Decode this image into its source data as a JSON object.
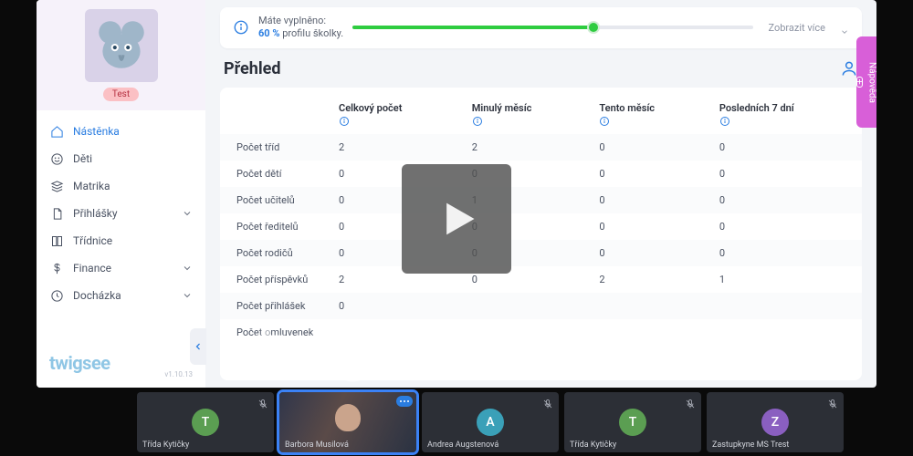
{
  "sidebar": {
    "badge": "Test",
    "items": [
      {
        "label": "Nástěnka",
        "icon": "home",
        "active": true,
        "expandable": false
      },
      {
        "label": "Děti",
        "icon": "smile",
        "active": false,
        "expandable": false
      },
      {
        "label": "Matrika",
        "icon": "stack",
        "active": false,
        "expandable": false
      },
      {
        "label": "Přihlášky",
        "icon": "doc",
        "active": false,
        "expandable": true
      },
      {
        "label": "Třídnice",
        "icon": "book",
        "active": false,
        "expandable": false
      },
      {
        "label": "Finance",
        "icon": "dollar",
        "active": false,
        "expandable": true
      },
      {
        "label": "Docházka",
        "icon": "clock",
        "active": false,
        "expandable": true
      }
    ],
    "brand": "twigsee",
    "version": "v1.10.13"
  },
  "notice": {
    "line1": "Máte vyplněno:",
    "pct": "60 %",
    "line2": "profilu školky.",
    "progress": 60,
    "more": "Zobrazit více"
  },
  "page_title": "Přehled",
  "help_label": "Nápověda",
  "table": {
    "row_header": "",
    "cols": [
      "Celkový počet",
      "Minulý měsíc",
      "Tento měsíc",
      "Posledních 7 dní"
    ],
    "rows": [
      {
        "label": "Počet tříd",
        "vals": [
          "2",
          "2",
          "0",
          "0"
        ]
      },
      {
        "label": "Počet dětí",
        "vals": [
          "0",
          "0",
          "0",
          "0"
        ]
      },
      {
        "label": "Počet učitelů",
        "vals": [
          "0",
          "1",
          "0",
          "0"
        ]
      },
      {
        "label": "Počet ředitelů",
        "vals": [
          "0",
          "0",
          "0",
          "0"
        ]
      },
      {
        "label": "Počet rodičů",
        "vals": [
          "0",
          "0",
          "0",
          "0"
        ]
      },
      {
        "label": "Počet příspěvků",
        "vals": [
          "2",
          "0",
          "2",
          "1"
        ]
      },
      {
        "label": "Počet přihlášek",
        "vals": [
          "0",
          "",
          "",
          ""
        ]
      },
      {
        "label": "Počet omluvenek",
        "vals": [
          "",
          "",
          "",
          ""
        ]
      }
    ]
  },
  "watermark": "twigsee",
  "dock": [
    {
      "name": "Třída Kytičky",
      "initial": "T",
      "color": "#5b9e52",
      "type": "avatar"
    },
    {
      "name": "Barbora Musilová",
      "type": "camera",
      "active": true
    },
    {
      "name": "Andrea Augstenová",
      "initial": "A",
      "color": "#3aa0b8",
      "type": "avatar"
    },
    {
      "name": "Třída Kytičky",
      "initial": "T",
      "color": "#5b9e52",
      "type": "avatar"
    },
    {
      "name": "Zastupkyne MS Trest",
      "initial": "Z",
      "color": "#8a5fc0",
      "type": "avatar"
    }
  ]
}
